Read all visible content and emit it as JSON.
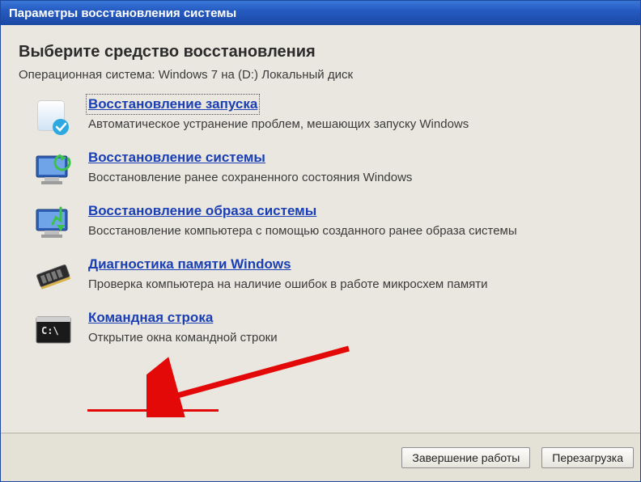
{
  "window": {
    "title": "Параметры восстановления системы"
  },
  "heading": "Выберите средство восстановления",
  "subline": "Операционная система: Windows 7 на (D:) Локальный диск",
  "options": [
    {
      "link": "Восстановление запуска",
      "desc": "Автоматическое устранение проблем, мешающих запуску Windows"
    },
    {
      "link": "Восстановление системы",
      "desc": "Восстановление ранее сохраненного состояния Windows"
    },
    {
      "link": "Восстановление образа системы",
      "desc": "Восстановление компьютера с помощью  созданного ранее образа системы"
    },
    {
      "link": "Диагностика памяти Windows",
      "desc": "Проверка компьютера на наличие ошибок в работе микросхем памяти"
    },
    {
      "link": "Командная строка",
      "desc": "Открытие окна командной строки"
    }
  ],
  "buttons": {
    "shutdown": "Завершение работы",
    "restart": "Перезагрузка"
  }
}
